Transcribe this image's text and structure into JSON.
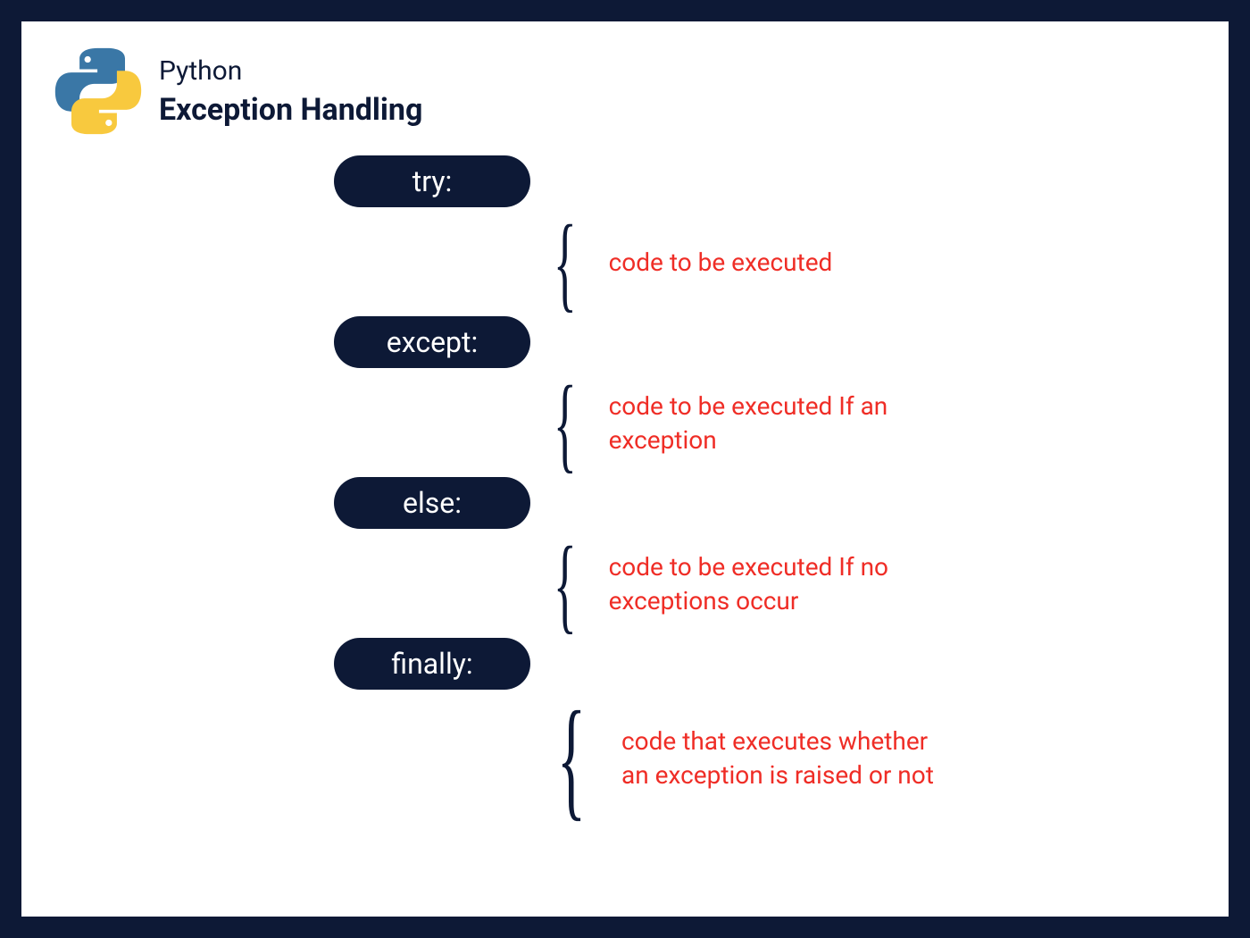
{
  "header": {
    "subtitle": "Python",
    "title": "Exception Handling",
    "logo_name": "python-logo"
  },
  "blocks": [
    {
      "keyword": "try:",
      "description": "code to be executed"
    },
    {
      "keyword": "except:",
      "description": "code to be executed If an exception"
    },
    {
      "keyword": "else:",
      "description": "code to be executed If no exceptions occur"
    },
    {
      "keyword": "finally:",
      "description": "code that executes whether an exception is raised or not"
    }
  ]
}
